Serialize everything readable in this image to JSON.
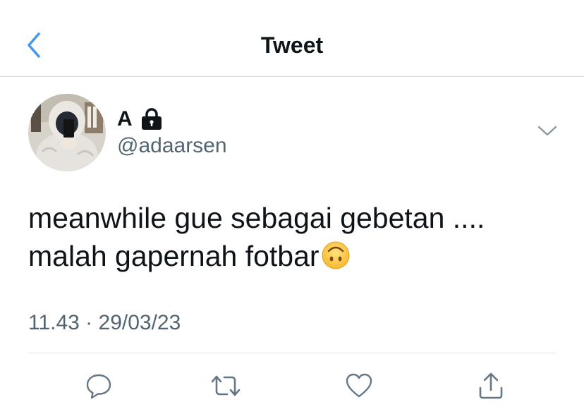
{
  "header": {
    "title": "Tweet",
    "back_icon": "chevron-left-icon",
    "accent_color": "#4a97e8"
  },
  "tweet": {
    "author": {
      "name": "A",
      "handle": "@adaarsen",
      "protected_icon": "lock-icon"
    },
    "text_lines": [
      "meanwhile gue sebagai gebetan ....",
      "malah gapernah fotbar"
    ],
    "emoji": "upside-down-face",
    "timestamp": "11.43 · 29/03/23",
    "more_icon": "chevron-down-icon"
  },
  "actions": [
    {
      "name": "reply",
      "icon": "reply-icon"
    },
    {
      "name": "retweet",
      "icon": "retweet-icon"
    },
    {
      "name": "like",
      "icon": "heart-icon"
    },
    {
      "name": "share",
      "icon": "share-icon"
    }
  ],
  "colors": {
    "text": "#0f1419",
    "secondary_text": "#536471",
    "icon_gray": "#657786"
  }
}
